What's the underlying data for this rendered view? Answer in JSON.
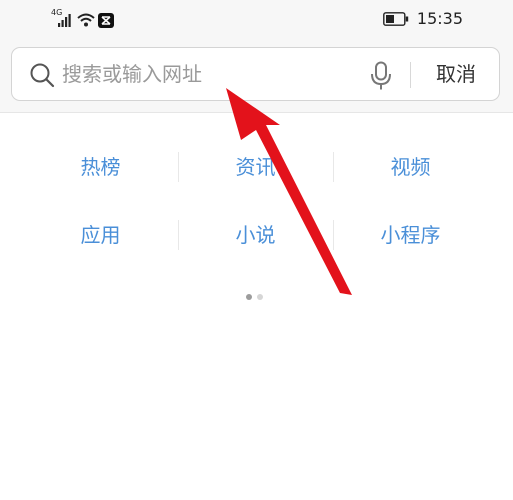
{
  "status_bar": {
    "signal_label": "4G",
    "time": "15:35",
    "icons": [
      "signal-icon",
      "wifi-icon",
      "capcut-app-icon",
      "battery-icon"
    ]
  },
  "search": {
    "placeholder": "搜索或输入网址",
    "value": "",
    "cancel_label": "取消",
    "icons": [
      "search-icon",
      "mic-icon"
    ]
  },
  "quick_links": {
    "rows": [
      [
        "热榜",
        "资讯",
        "视频"
      ],
      [
        "应用",
        "小说",
        "小程序"
      ]
    ]
  },
  "pager": {
    "pages": 2,
    "current": 1
  },
  "annotation": {
    "arrow_color": "#e3121b",
    "points_to": "search-input"
  },
  "colors": {
    "link": "#4a8fd8",
    "header_bg": "#f7f7f7"
  }
}
